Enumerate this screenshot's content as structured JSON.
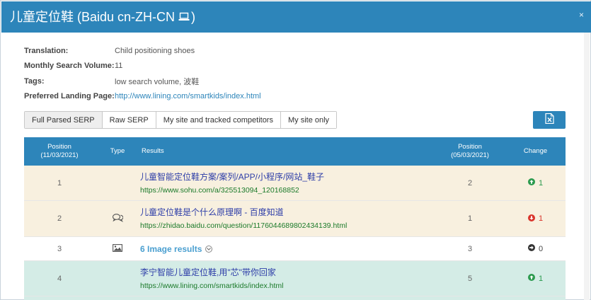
{
  "dialog": {
    "title": "儿童定位鞋 (Baidu cn-ZH-CN",
    "title_close_paren": ")",
    "close_symbol": "×",
    "accent_color": "#2d85ba"
  },
  "meta": {
    "translation_label": "Translation:",
    "translation_value": "Child positioning shoes",
    "volume_label": "Monthly Search Volume:",
    "volume_value": "11",
    "tags_label": "Tags:",
    "tags_value": "low search volume, 波鞋",
    "landing_label": "Preferred Landing Page:",
    "landing_value": "http://www.lining.com/smartkids/index.html"
  },
  "tabs": [
    {
      "label": "Full Parsed SERP",
      "active": true
    },
    {
      "label": "Raw SERP",
      "active": false
    },
    {
      "label": "My site and tracked competitors",
      "active": false
    },
    {
      "label": "My site only",
      "active": false
    }
  ],
  "export_icon": "excel-export-icon",
  "table": {
    "headers": {
      "position_line1": "Position",
      "position_line2": "(11/03/2021)",
      "type": "Type",
      "results": "Results",
      "position2_line1": "Position",
      "position2_line2": "(05/03/2021)",
      "change": "Change"
    },
    "rows": [
      {
        "position": "1",
        "type_icon": "",
        "title": "儿童智能定位鞋方案/案列/APP/小程序/网站_鞋子",
        "url": "https://www.sohu.com/a/325513094_120168852",
        "position2": "2",
        "change": "1",
        "direction": "up"
      },
      {
        "position": "2",
        "type_icon": "speech-bubbles-icon",
        "title": "儿童定位鞋是个什么原理啊 - 百度知道",
        "url": "https://zhidao.baidu.com/question/1176044689802434139.html",
        "position2": "1",
        "change": "1",
        "direction": "down"
      },
      {
        "position": "3",
        "type_icon": "image-icon",
        "title": "6 Image results",
        "url": "",
        "position2": "3",
        "change": "0",
        "direction": "flat"
      },
      {
        "position": "4",
        "type_icon": "",
        "title": "李宁智能儿童定位鞋,用\"芯\"带你回家",
        "url": "https://www.lining.com/smartkids/index.html",
        "position2": "5",
        "change": "1",
        "direction": "up"
      }
    ]
  }
}
